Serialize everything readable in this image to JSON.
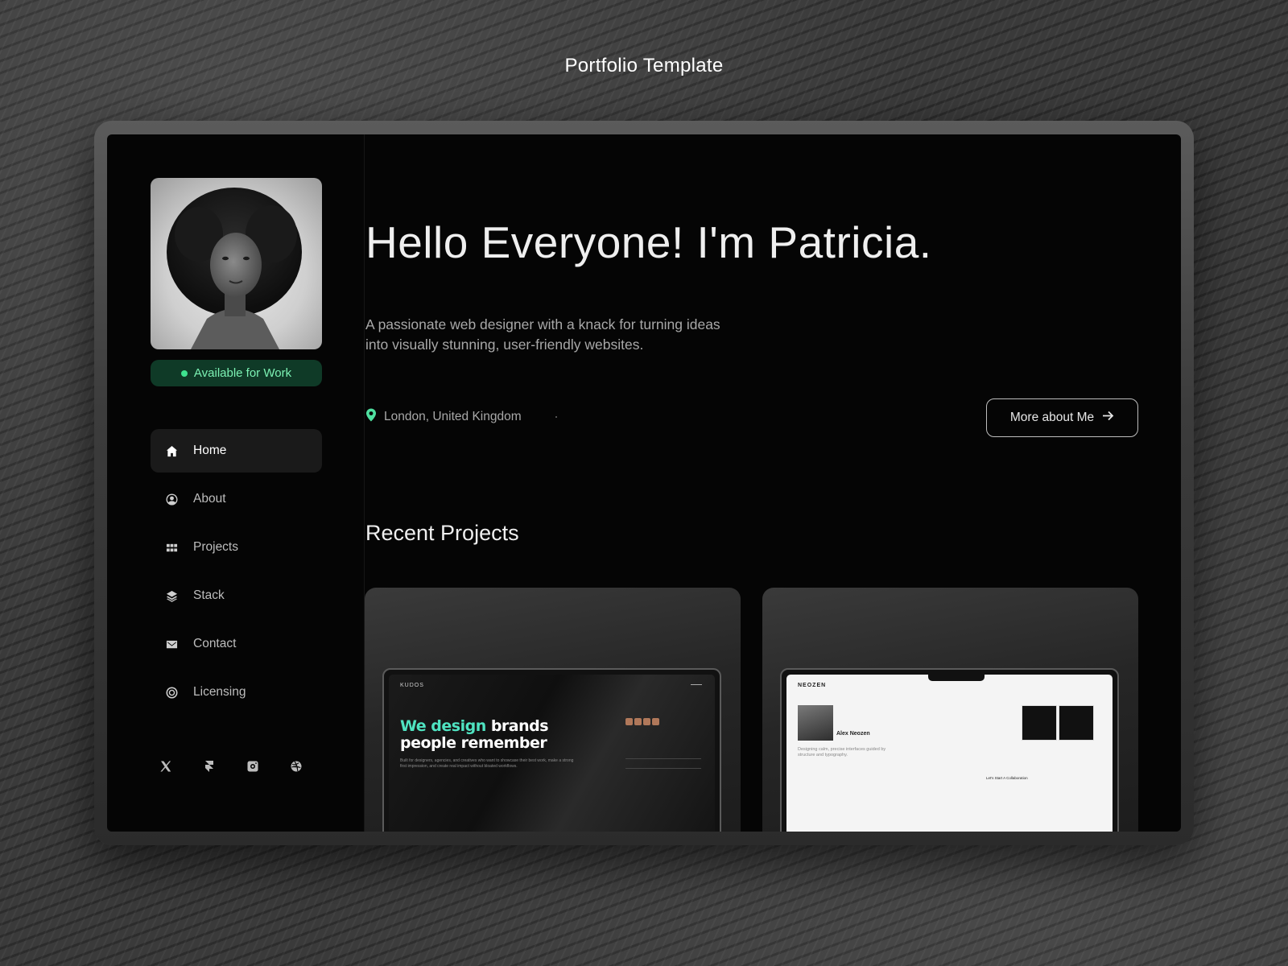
{
  "page_heading": "Portfolio Template",
  "profile": {
    "status_label": "Available for Work",
    "status_color": "#3ee28f"
  },
  "nav": {
    "items": [
      {
        "label": "Home",
        "icon": "home-icon",
        "active": true
      },
      {
        "label": "About",
        "icon": "user-circle-icon",
        "active": false
      },
      {
        "label": "Projects",
        "icon": "grid-icon",
        "active": false
      },
      {
        "label": "Stack",
        "icon": "layers-icon",
        "active": false
      },
      {
        "label": "Contact",
        "icon": "mail-icon",
        "active": false
      },
      {
        "label": "Licensing",
        "icon": "licensing-icon",
        "active": false
      }
    ]
  },
  "socials": [
    "x-icon",
    "framer-icon",
    "instagram-icon",
    "dribbble-icon"
  ],
  "hero": {
    "title": "Hello Everyone! I'm Patricia.",
    "description": "A passionate web designer with a knack for turning ideas into visually stunning, user-friendly websites.",
    "location": "London, United Kingdom",
    "cta_label": "More about Me"
  },
  "projects": {
    "section_title": "Recent Projects",
    "cards": [
      {
        "logo": "KUDOS",
        "headline_accent": "We design",
        "headline_rest": " brands",
        "headline_line2": "people remember",
        "subtext": "Built for designers, agencies, and creatives who want to showcase their best work, make a strong first impression, and create real impact without bloated workflows."
      },
      {
        "logo": "NEOZEN",
        "name": "Alex Neozen",
        "tagline": "Designing calm, precise interfaces guided by structure and typography.",
        "cta": "Let's Start A Collaboration"
      }
    ]
  },
  "colors": {
    "accent_green": "#4fe0a0",
    "accent_teal": "#4fe3c1",
    "screen_bg": "#050505"
  }
}
